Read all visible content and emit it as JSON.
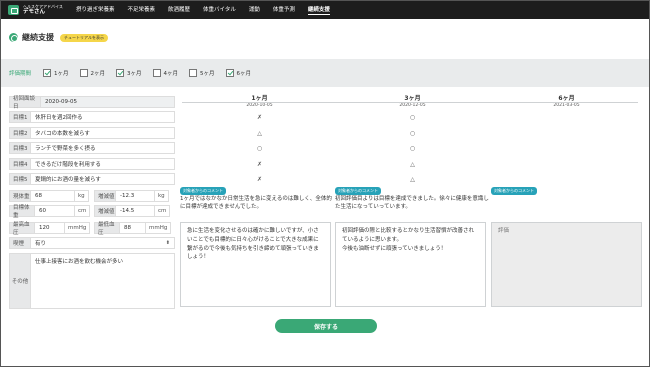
{
  "header": {
    "logo_sub": "ヘルスケアアドバイス",
    "logo_name": "デモさん",
    "nav": [
      "摂り過ぎ栄養素",
      "不足栄養素",
      "飲酒履歴",
      "体重バイタル",
      "運動",
      "体重予測",
      "継続支援"
    ],
    "active_index": 6
  },
  "page": {
    "title": "継続支援",
    "tutorial_badge": "チュートリアルを表示"
  },
  "period": {
    "label": "評価期間",
    "options": [
      {
        "label": "1ヶ月",
        "checked": true
      },
      {
        "label": "2ヶ月",
        "checked": false
      },
      {
        "label": "3ヶ月",
        "checked": true
      },
      {
        "label": "4ヶ月",
        "checked": false
      },
      {
        "label": "5ヶ月",
        "checked": false
      },
      {
        "label": "6ヶ月",
        "checked": true
      }
    ]
  },
  "left": {
    "first_date_label": "初回面談日",
    "first_date": "2020-09-05",
    "goals": [
      {
        "label": "目標1",
        "value": "休肝日を週2回作る"
      },
      {
        "label": "目標2",
        "value": "タバコの本数を減らす"
      },
      {
        "label": "目標3",
        "value": "ランチで野菜を多く摂る"
      },
      {
        "label": "目標4",
        "value": "できるだけ階段を利用する"
      },
      {
        "label": "目標5",
        "value": "夏鍋的にお酒の量を減らす"
      }
    ],
    "weight_label": "現体重",
    "weight": "68",
    "weight_unit": "kg",
    "weight_change_label": "増減値",
    "weight_change": "-12.3",
    "weight_change_unit": "kg",
    "target_weight_label": "目標体重",
    "target_weight": "60",
    "target_weight_unit": "cm",
    "waist_change_label": "増減値",
    "waist_change": "-14.5",
    "waist_change_unit": "cm",
    "sys_label": "最高血圧",
    "sys": "120",
    "sys_unit": "mmHg",
    "dia_label": "最低血圧",
    "dia": "88",
    "dia_unit": "mmHg",
    "smoke_label": "喫煙",
    "smoke": "有り",
    "other_label": "その他",
    "other": "仕事上接客にお酒を飲む機会が多い"
  },
  "columns": [
    {
      "month": "1ヶ月",
      "date": "2020-10-05",
      "marks": [
        "✗",
        "△",
        "○",
        "✗",
        "✗"
      ],
      "tag": "対象者からのコメント",
      "comment": "1ヶ月ではなかなか日常生活を急に変えるのは難しく、全体的に目標が達成できませんでした。",
      "response": "急に生活を変化させるのは確かに難しいですが、小さいことでも目標的に日々心がけることで大きな成果に繋がるので今後も気持ちを引き締めて頑張っていきましょう！"
    },
    {
      "month": "3ヶ月",
      "date": "2020-12-05",
      "marks": [
        "○",
        "○",
        "○",
        "△",
        "△"
      ],
      "tag": "対象者からのコメント",
      "comment": "初回評価目よりは目標を達成できました。徐々に健康を意識した生活になっていっています。",
      "response": "初回評価の際と比較するとかなり生活習慣が改善されているように思います。\n今後も油断せずに頑張っていきましょう！"
    },
    {
      "month": "6ヶ月",
      "date": "2021-03-05",
      "marks": [
        "",
        "",
        "",
        "",
        ""
      ],
      "tag": "対象者からのコメント",
      "comment": "",
      "response": "評価"
    }
  ],
  "save_label": "保存する"
}
